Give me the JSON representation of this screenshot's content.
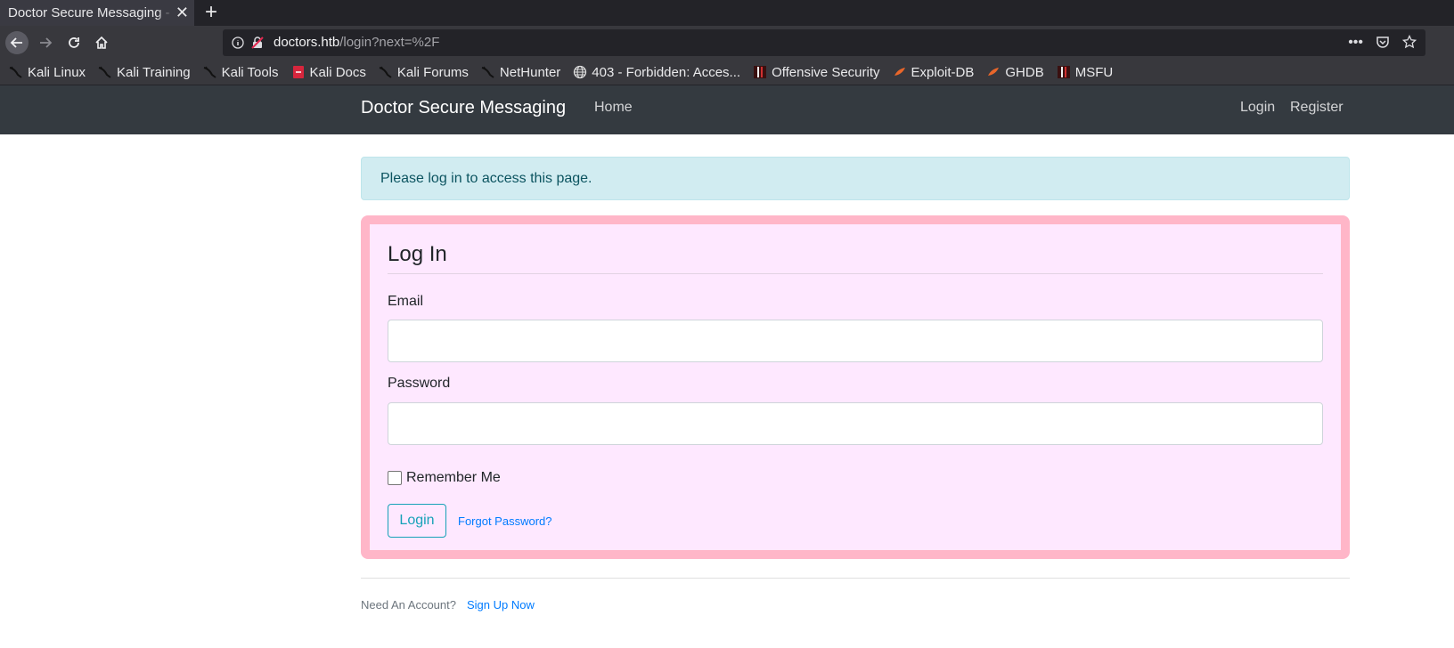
{
  "browser": {
    "tab_title": "Doctor Secure Messaging - Login",
    "url_host": "doctors.htb",
    "url_path": "/login?next=%2F",
    "bookmarks": [
      {
        "label": "Kali Linux",
        "icon": "kali-dragon-icon"
      },
      {
        "label": "Kali Training",
        "icon": "kali-dragon-icon"
      },
      {
        "label": "Kali Tools",
        "icon": "kali-dragon-icon"
      },
      {
        "label": "Kali Docs",
        "icon": "kali-docs-icon"
      },
      {
        "label": "Kali Forums",
        "icon": "kali-dragon-icon"
      },
      {
        "label": "NetHunter",
        "icon": "kali-dragon-icon"
      },
      {
        "label": "403 - Forbidden: Acces...",
        "icon": "globe-icon"
      },
      {
        "label": "Offensive Security",
        "icon": "offsec-icon"
      },
      {
        "label": "Exploit-DB",
        "icon": "exploitdb-icon"
      },
      {
        "label": "GHDB",
        "icon": "exploitdb-icon"
      },
      {
        "label": "MSFU",
        "icon": "offsec-icon"
      }
    ]
  },
  "site": {
    "brand": "Doctor Secure Messaging",
    "nav_home": "Home",
    "nav_login": "Login",
    "nav_register": "Register"
  },
  "alert": "Please log in to access this page.",
  "form": {
    "legend": "Log In",
    "email_label": "Email",
    "email_value": "",
    "password_label": "Password",
    "password_value": "",
    "remember_label": "Remember Me",
    "remember_checked": false,
    "submit_label": "Login",
    "forgot_label": "Forgot Password?"
  },
  "footer": {
    "text": "Need An Account?",
    "link": "Sign Up Now"
  },
  "colors": {
    "site_nav_bg": "#343a40",
    "alert_bg": "#d1ecf1",
    "card_bg": "#fee8ff",
    "card_border": "#ffb6c8",
    "info": "#17a2b8",
    "link": "#007bff"
  }
}
